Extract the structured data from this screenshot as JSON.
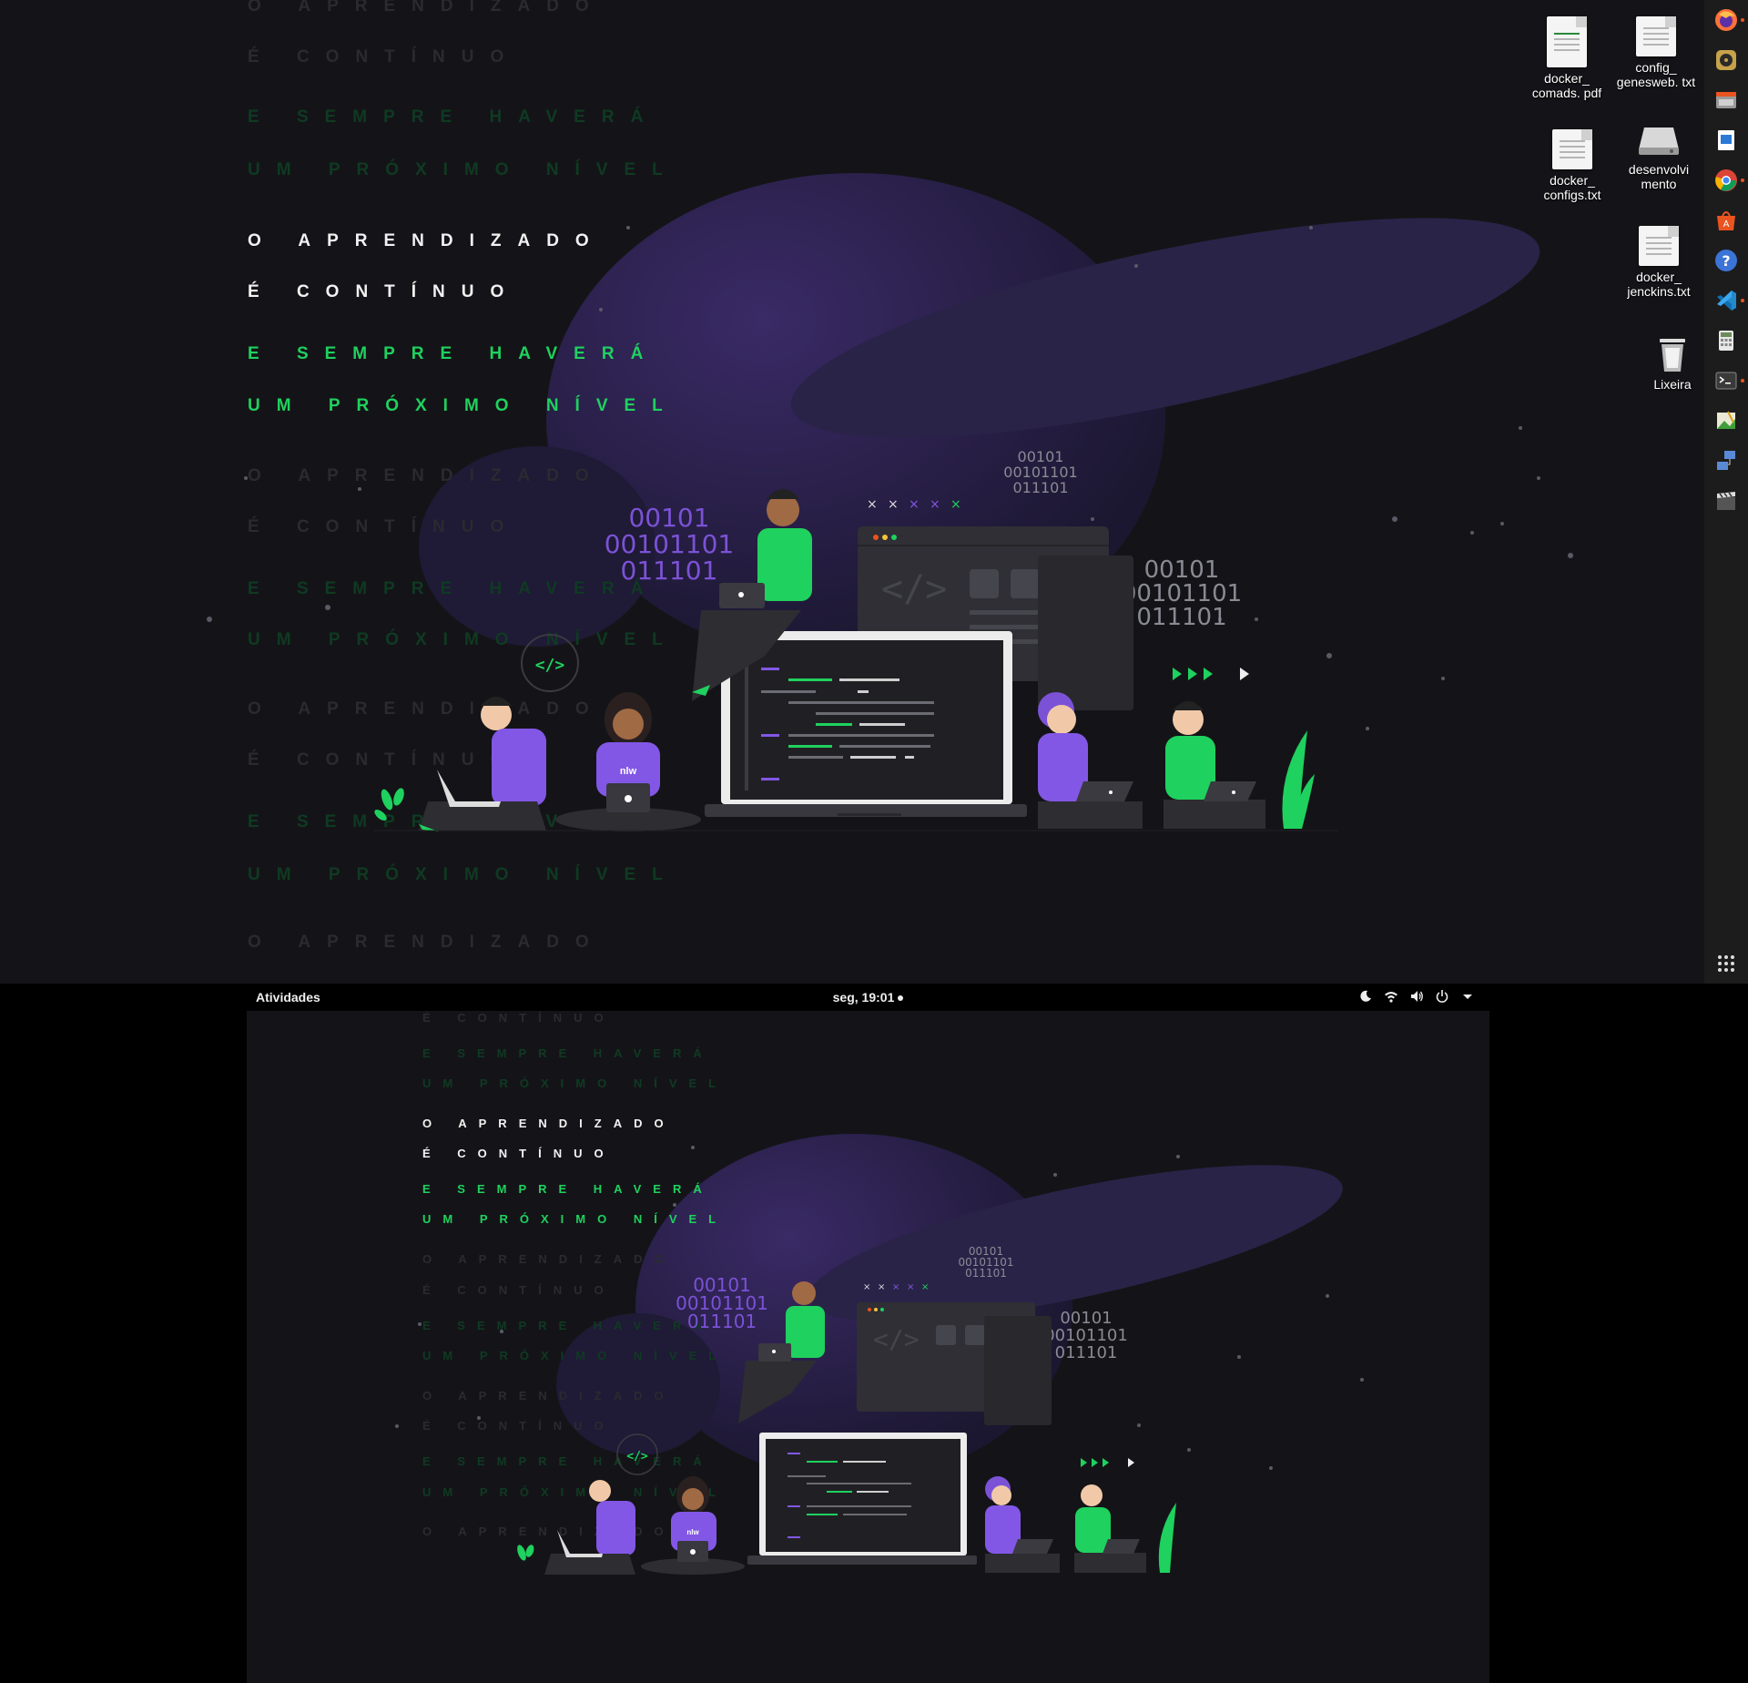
{
  "wallpaper": {
    "line1": "O APRENDIZADO",
    "line2": "É CONTÍNUO",
    "line3": "E SEMPRE HAVERÁ",
    "line4": "UM PRÓXIMO NÍVEL",
    "binary": [
      "00101",
      "00101101",
      "011101"
    ],
    "code_bubble": "</>",
    "shirt_text": "nlw"
  },
  "desktop": {
    "icons": [
      {
        "name": "docker_ comads. pdf"
      },
      {
        "name": "config_ genesweb. txt"
      },
      {
        "name": "docker_ configs.txt"
      },
      {
        "name": "desenvolvi mento"
      },
      {
        "name": "docker_ jenckins.txt"
      },
      {
        "name": "Lixeira"
      }
    ]
  },
  "dock": {
    "items": [
      "firefox-icon",
      "rhythmbox-icon",
      "files-icon",
      "writer-icon",
      "chrome-icon",
      "software-icon",
      "help-icon",
      "vscode-icon",
      "calculator-icon",
      "terminal-icon",
      "image-viewer-icon",
      "network-icon",
      "video-icon"
    ],
    "apps_grid": "show-applications-icon"
  },
  "topbar": {
    "activities": "Atividades",
    "clock": "seg, 19:01"
  },
  "colors": {
    "accent_green": "#1fd15e",
    "accent_purple": "#8257e5",
    "background": "#141418"
  }
}
